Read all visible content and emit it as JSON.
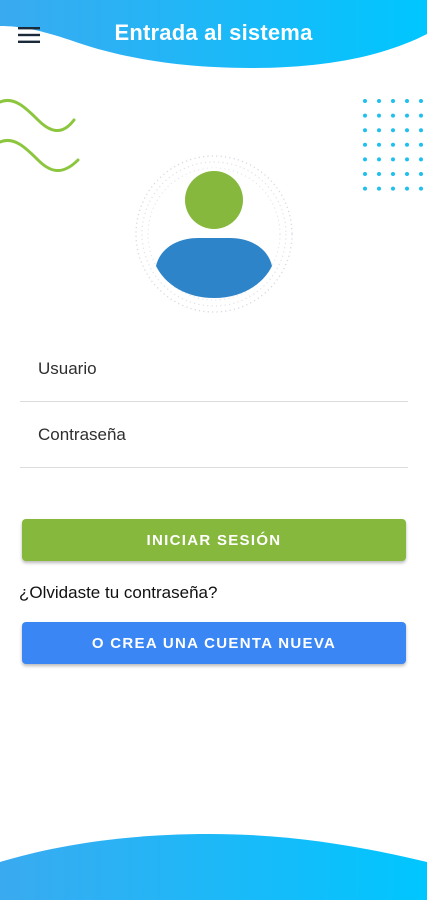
{
  "header": {
    "title": "Entrada al sistema",
    "menu_icon": "hamburger-menu-icon"
  },
  "colors": {
    "header_gradient_start": "#36b2f2",
    "header_gradient_end": "#00c3ff",
    "accent_green": "#86b83d",
    "accent_blue": "#3b86f5",
    "avatar_head": "#86b83d",
    "avatar_body": "#2e84c9",
    "decor_dots": "#1ec0f0"
  },
  "form": {
    "username_placeholder": "Usuario",
    "password_placeholder": "Contraseña"
  },
  "actions": {
    "login_label": "INICIAR SESIÓN",
    "forgot_label": "¿Olvidaste tu contraseña?",
    "create_account_label": "O CREA UNA CUENTA NUEVA"
  },
  "decor": {
    "avatar_icon": "user-avatar-icon",
    "waves_icon": "decorative-waves-icon",
    "dots_icon": "decorative-dots-icon"
  }
}
